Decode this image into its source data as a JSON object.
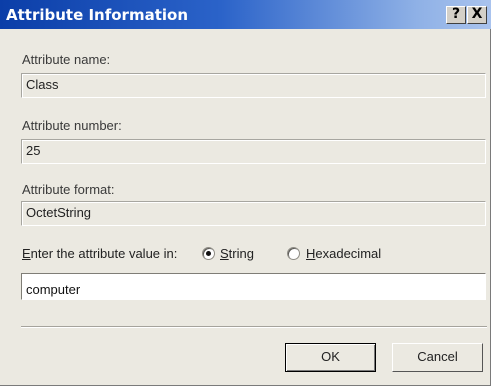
{
  "window": {
    "title": "Attribute Information",
    "help_glyph": "?",
    "close_glyph": "X"
  },
  "fields": {
    "name_label": "Attribute name:",
    "name_value": "Class",
    "number_label": "Attribute number:",
    "number_value": "25",
    "format_label": "Attribute format:",
    "format_value": "OctetString"
  },
  "value_entry": {
    "label_prefix": "E",
    "label_rest": "nter the attribute value in:",
    "option_string_hot": "S",
    "option_string_rest": "tring",
    "option_hex_hot": "H",
    "option_hex_rest": "exadecimal",
    "selected": "String",
    "value": "computer"
  },
  "buttons": {
    "ok": "OK",
    "cancel": "Cancel"
  },
  "colors": {
    "title_bar_start": "#0b3ea8",
    "title_bar_end": "#a9c3ee",
    "dialog_bg": "#ebe9e1"
  }
}
